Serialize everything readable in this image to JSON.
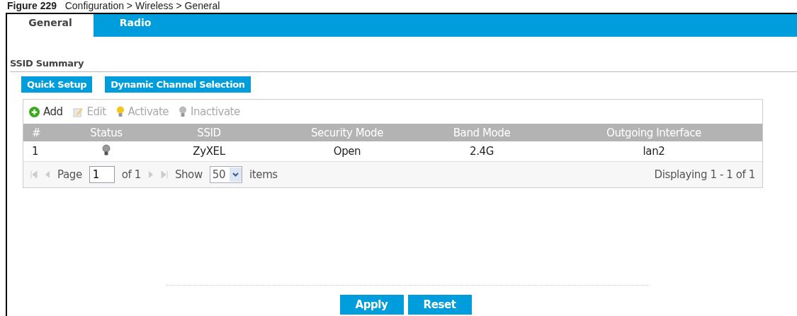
{
  "caption": "**Figure 229**   Configuration > Wireless > General",
  "tabs": [
    {
      "label": "General",
      "selected": true
    },
    {
      "label": "Radio",
      "selected": false
    }
  ],
  "section_title": "SSID Summary",
  "actions": [
    "Quick Setup",
    "Dynamic Channel Selection"
  ],
  "toolbar": [
    {
      "kind": "add",
      "label": "Add",
      "disabled": false
    },
    {
      "kind": "edit",
      "label": "Edit",
      "disabled": true
    },
    {
      "kind": "activate",
      "label": "Activate",
      "disabled": true
    },
    {
      "kind": "inactivate",
      "label": "Inactivate",
      "disabled": true
    }
  ],
  "table": {
    "columns": [
      "#",
      "Status",
      "SSID",
      "Security Mode",
      "Band Mode",
      "Outgoing Interface"
    ],
    "rows": [
      {
        "index": "1",
        "active": false,
        "ssid": "ZyXEL",
        "security": "Open",
        "band": "2.4G",
        "interface": "lan2"
      }
    ]
  },
  "pager": {
    "page_label": "Page",
    "page": "1",
    "of": "of 1",
    "show_label": "Show",
    "per_page": "50",
    "items_label": "items",
    "summary": "Displaying 1 - 1 of 1"
  },
  "buttons": [
    "Apply",
    "Reset"
  ]
}
